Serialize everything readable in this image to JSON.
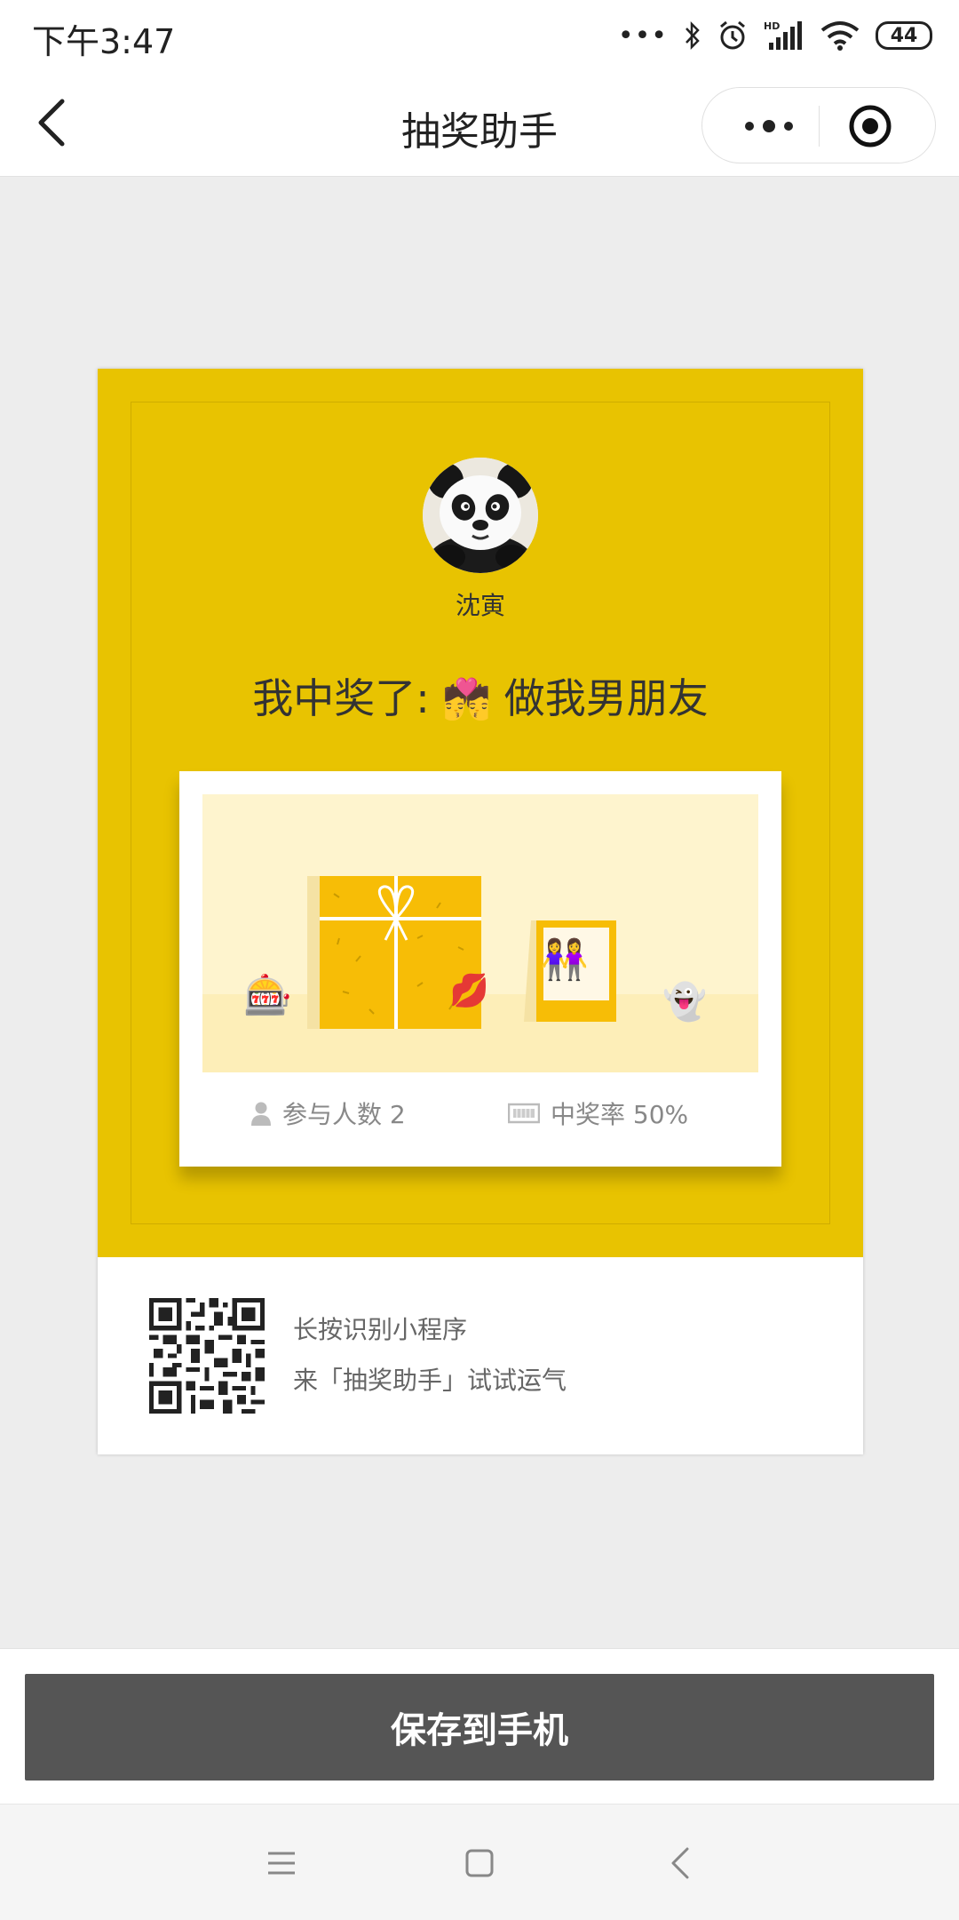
{
  "status_bar": {
    "time": "下午3:47",
    "battery": "44"
  },
  "nav": {
    "title": "抽奖助手"
  },
  "card": {
    "username": "沈寅",
    "win_prefix": "我中奖了:",
    "win_emoji": "💏",
    "win_prize": "做我男朋友",
    "scene_emojis": [
      "🎰",
      "💋",
      "👭",
      "👻"
    ],
    "participants_label": "参与人数 2",
    "win_rate_label": "中奖率 50%",
    "qr_line1": "长按识别小程序",
    "qr_line2": "来「抽奖助手」试试运气"
  },
  "save_button": "保存到手机",
  "colors": {
    "card_yellow": "#e8c301",
    "save_button_bg": "#555555",
    "page_bg": "#ededed"
  },
  "icons": [
    "back-icon",
    "more-icon",
    "close-capsule-icon",
    "person-icon",
    "ticket-icon",
    "qr-code",
    "menu-nav-icon",
    "home-nav-icon",
    "back-nav-icon"
  ]
}
